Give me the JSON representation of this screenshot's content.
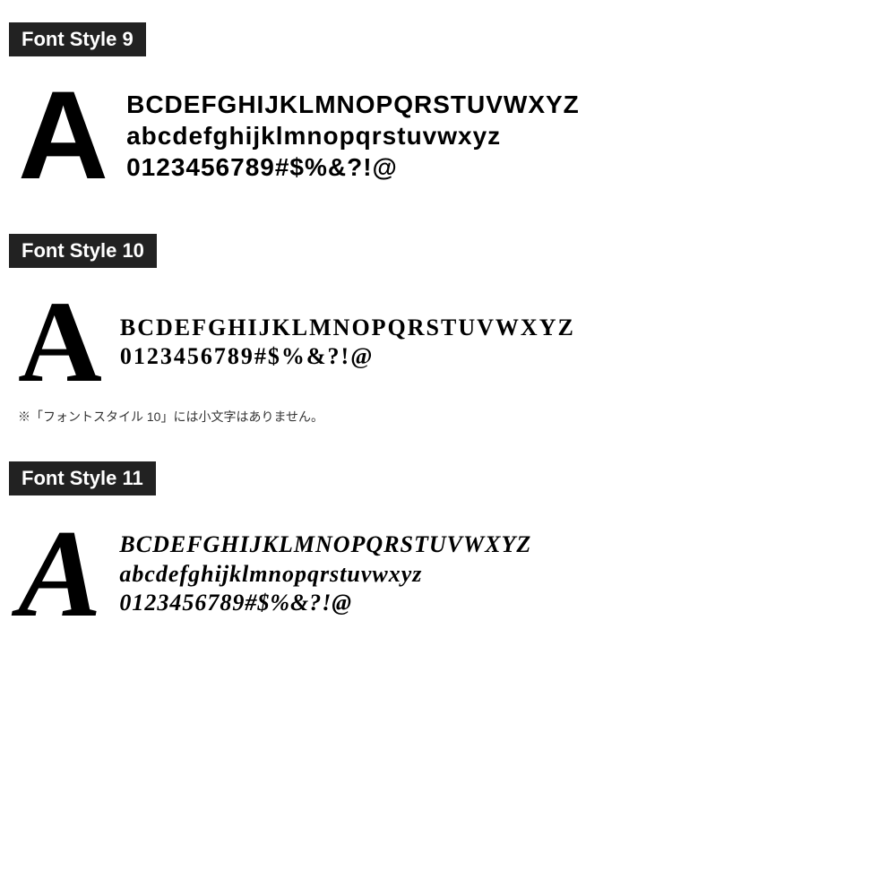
{
  "sections": [
    {
      "id": "style9",
      "title": "Font Style 9",
      "bigLetter": "A",
      "lines": [
        "BCDEFGHIJKLMNOPQRSTUVWXYZ",
        "abcdefghijklmnopqrstuvwxyz",
        "0123456789#$%&?!@"
      ],
      "note": null
    },
    {
      "id": "style10",
      "title": "Font Style 10",
      "bigLetter": "A",
      "lines": [
        "BCDEFGHIJKLMNOPQRSTUVWXYZ",
        "0123456789#$%&?!@"
      ],
      "note": "※「フォントスタイル 10」には小文字はありません。"
    },
    {
      "id": "style11",
      "title": "Font Style 11",
      "bigLetter": "A",
      "lines": [
        "BCDEFGHIJKLMNOPQRSTUVWXYZ",
        "abcdefghijklmnopqrstuvwxyz",
        "0123456789#$%&?!@"
      ],
      "note": null
    }
  ]
}
